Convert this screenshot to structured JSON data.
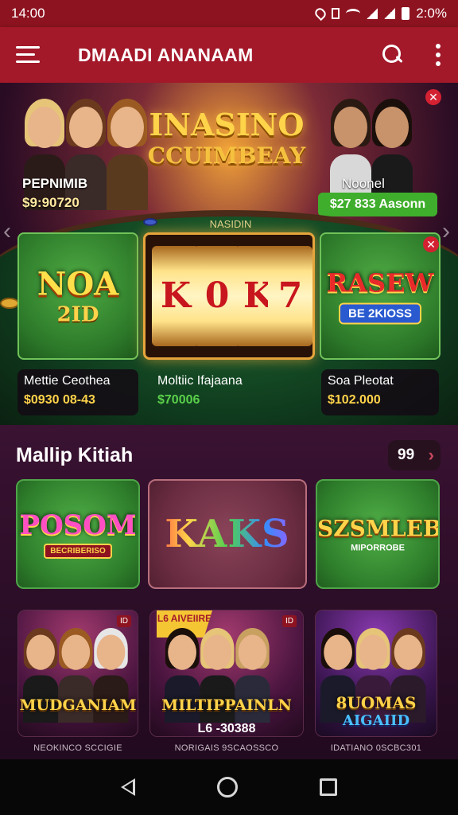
{
  "status_bar": {
    "time": "14:00",
    "battery": "2:0%"
  },
  "app_bar": {
    "title": "DMAADI ANANAAM"
  },
  "hero": {
    "title_line1": "INASINO",
    "title_line2": "CCUIMBEAY",
    "left_label": "PEPNIMIB",
    "left_amount": "$9:90720",
    "right_label": "Noonel",
    "right_amount": "$27 833 Aasonn",
    "table_text": "NASIDIN"
  },
  "featured_games": [
    {
      "logo": "NOA",
      "logo_sub": "2ID",
      "name": "Mettie Ceothea",
      "amount": "$0930 08-43"
    },
    {
      "reels": [
        "K",
        "0",
        "K",
        "7"
      ],
      "name": "Moltiic Ifajaana",
      "amount": "$70006"
    },
    {
      "logo": "RASEW",
      "logo_sub": "BE 2KIOSS",
      "name": "Soa Pleotat",
      "amount": "$102.000"
    }
  ],
  "section": {
    "title": "Mallip Kitiah",
    "count": "99"
  },
  "tiles": [
    {
      "logo": "POSOM",
      "logo_sub": "BECRIBERISO"
    },
    {
      "logo": "KAKS"
    },
    {
      "logo": "SZSMLEB",
      "logo_sub": "MIPORROBE"
    }
  ],
  "promos": [
    {
      "title": "MUDGANIAM",
      "sub": "",
      "badge": "ID",
      "caption": "NEOKINCO SCCIGIE"
    },
    {
      "title": "MILTIPPAINLN",
      "sub": "L6 -30388",
      "flag": "L6 AIVEIIRE",
      "badge": "ID",
      "caption": "NORIGAIS 9SCAOSSCO"
    },
    {
      "title": "8UOMAS",
      "title2": "AIGAIID",
      "sub": "",
      "badge": "",
      "caption": "IDATIANO 0SCBC301"
    }
  ],
  "colors": {
    "app_bar": "#a3192a",
    "status_bar": "#8e1320",
    "accent_green": "#3fae2c",
    "gold": "#ffd34a",
    "section_bg": "#3a1232"
  },
  "icons": [
    "menu-icon",
    "search-icon",
    "more-vert-icon",
    "close-icon",
    "chevron-left-icon",
    "chevron-right-icon",
    "nav-back-icon",
    "nav-home-icon",
    "nav-recent-icon"
  ]
}
